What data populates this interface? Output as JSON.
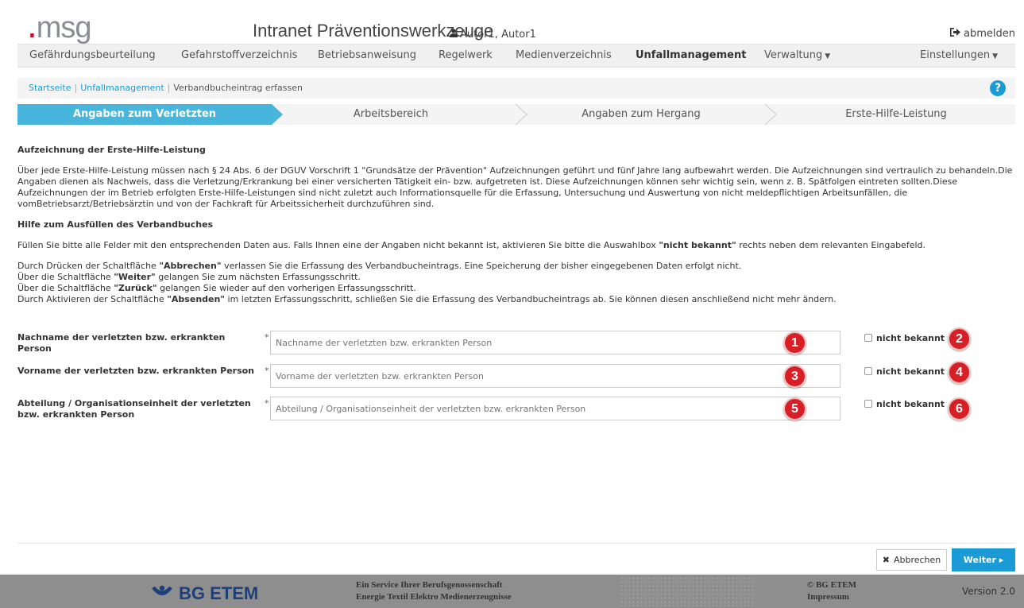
{
  "header": {
    "logo_text": "msg",
    "app_title": "Intranet Präventionswerkzeuge",
    "user": "Autor1, Autor1",
    "logout": "abmelden"
  },
  "nav": {
    "items": [
      {
        "label": "Gefährdungsbeurteilung"
      },
      {
        "label": "Gefahrstoffverzeichnis"
      },
      {
        "label": "Betriebsanweisung"
      },
      {
        "label": "Regelwerk"
      },
      {
        "label": "Medienverzeichnis"
      },
      {
        "label": "Unfallmanagement",
        "active": true
      },
      {
        "label": "Verwaltung"
      },
      {
        "label": "Einstellungen"
      }
    ]
  },
  "breadcrumb": {
    "home": "Startseite",
    "section": "Unfallmanagement",
    "current": "Verbandbucheintrag erfassen",
    "separator": "|"
  },
  "steps": [
    {
      "label": "Angaben zum Verletzten",
      "active": true
    },
    {
      "label": "Arbeitsbereich"
    },
    {
      "label": "Angaben zum Hergang"
    },
    {
      "label": "Erste-Hilfe-Leistung"
    }
  ],
  "content": {
    "heading1": "Aufzeichnung der Erste-Hilfe-Leistung",
    "para1": "Über jede Erste-Hilfe-Leistung müssen nach § 24 Abs. 6 der DGUV Vorschrift 1 \"Grundsätze der Prävention\" Aufzeichnungen geführt und fünf Jahre lang aufbewahrt werden. Die Aufzeichnungen sind vertraulich zu behandeln.Die Angaben dienen als Nachweis, dass die Verletzung/Erkrankung bei einer versicherten Tätigkeit ein- bzw. aufgetreten ist. Diese Aufzeichnungen können sehr wichtig sein, wenn z. B. Spätfolgen eintreten sollten.Diese Aufzeichnungen der im Betrieb erfolgten Erste-Hilfe-Leistungen sind nicht zuletzt auch Informationsquelle für die Erfassung, Untersuchung und Auswertung von nicht meldepflichtigen Arbeitsunfällen, die vomBetriebsarzt/Betriebsärztin und von der Fachkraft für Arbeitssicherheit durchzuführen sind.",
    "heading2": "Hilfe zum Ausfüllen des Verbandbuches",
    "para2_pre": "Füllen Sie bitte alle Felder mit den entsprechenden Daten aus. Falls Ihnen eine der Angaben nicht bekannt ist, aktivieren Sie bitte die Auswahlbox ",
    "para2_bold": "\"nicht bekannt\"",
    "para2_post": " rechts neben dem relevanten Eingabefeld.",
    "line1_pre": "Durch Drücken der Schaltfläche ",
    "line1_bold": "\"Abbrechen\"",
    "line1_post": " verlassen Sie die Erfassung des Verbandbucheintrags. Eine Speicherung der bisher eingegebenen Daten erfolgt nicht.",
    "line2_pre": "Über die Schaltfläche ",
    "line2_bold": "\"Weiter\"",
    "line2_post": " gelangen Sie zum nächsten Erfassungsschritt.",
    "line3_pre": "Über die Schaltfläche ",
    "line3_bold": "\"Zurück\"",
    "line3_post": " gelangen Sie wieder auf den vorherigen Erfassungsschritt.",
    "line4_pre": "Durch Aktivieren der Schaltfläche ",
    "line4_bold": "\"Absenden\"",
    "line4_post": " im letzten Erfassungsschritt, schließen Sie die Erfassung des Verbandbucheintrags ab. Sie können diesen anschließend nicht mehr ändern."
  },
  "form": {
    "required_mark": "*",
    "not_known_label": "nicht bekannt",
    "fields": [
      {
        "label": "Nachname der verletzten bzw. erkrankten Person",
        "placeholder": "Nachname der verletzten bzw. erkrankten Person",
        "value": "",
        "badge_input": "1",
        "badge_check": "2"
      },
      {
        "label": "Vorname der verletzten bzw. erkrankten Person",
        "placeholder": "Vorname der verletzten bzw. erkrankten Person",
        "value": "",
        "badge_input": "3",
        "badge_check": "4"
      },
      {
        "label": "Abteilung / Organisationseinheit der verletzten bzw. erkrankten Person",
        "placeholder": "Abteilung / Organisationseinheit der verletzten bzw. erkrankten Person",
        "value": "",
        "badge_input": "5",
        "badge_check": "6"
      }
    ]
  },
  "buttons": {
    "cancel": "Abbrechen",
    "next": "Weiter ▸"
  },
  "footer": {
    "brand": "BG ETEM",
    "service_line1": "Ein Service Ihrer Berufsgenossenschaft",
    "service_line2": "Energie Textil Elektro Medienerzeugnisse",
    "copyright": "© BG ETEM",
    "imprint": "Impressum",
    "version": "Version 2.0"
  },
  "colors": {
    "accent": "#1a9bd6",
    "step_active": "#47b5dc",
    "badge": "#d91f26",
    "footer": "#8e8e8e",
    "brand_blue": "#1d3f7a"
  }
}
